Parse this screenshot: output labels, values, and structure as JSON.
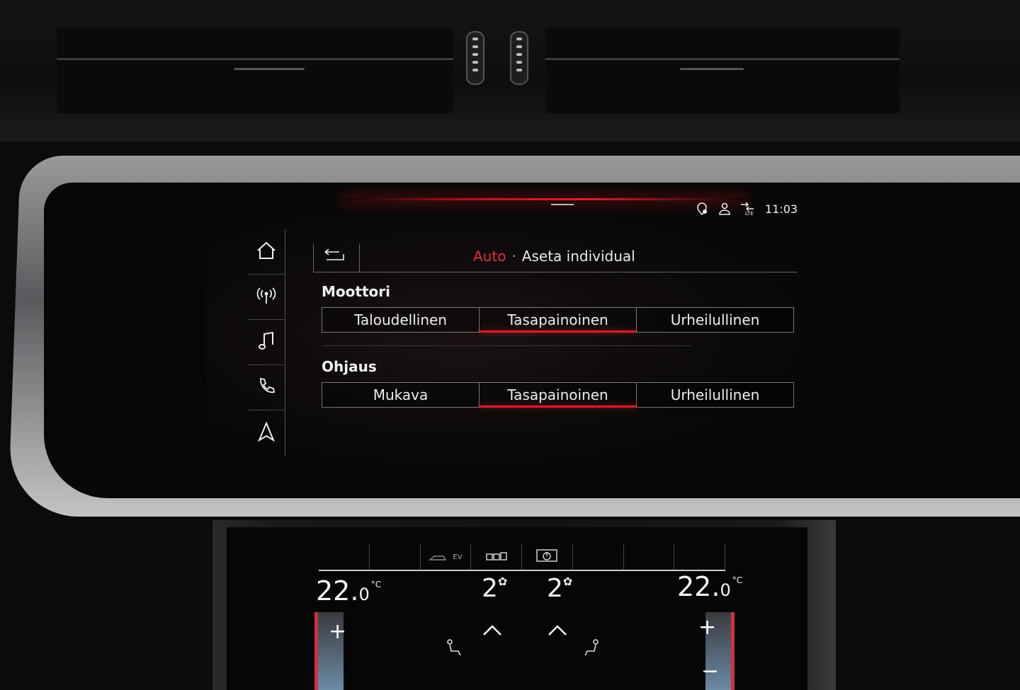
{
  "status_bar": {
    "time": "11:03",
    "icons": [
      "location-pin-icon",
      "user-profile-icon",
      "lte-signal-icon"
    ]
  },
  "sidebar": {
    "items": [
      {
        "id": "home",
        "icon": "home-icon"
      },
      {
        "id": "radio",
        "icon": "radio-antenna-icon"
      },
      {
        "id": "media",
        "icon": "music-note-icon"
      },
      {
        "id": "phone",
        "icon": "phone-icon"
      },
      {
        "id": "nav",
        "icon": "navigation-arrow-icon"
      }
    ]
  },
  "header": {
    "back_icon": "back-arrow-icon",
    "breadcrumb_parent": "Auto",
    "breadcrumb_separator": "·",
    "breadcrumb_current": "Aseta individual"
  },
  "sections": [
    {
      "title": "Moottori",
      "options": [
        "Taloudellinen",
        "Tasapainoinen",
        "Urheilullinen"
      ],
      "selected_index": 1
    },
    {
      "title": "Ohjaus",
      "options": [
        "Mukava",
        "Tasapainoinen",
        "Urheilullinen"
      ],
      "selected_index": 1
    }
  ],
  "colors": {
    "accent": "#d81e2a",
    "text": "#e9e9e9",
    "background": "#0a0808"
  },
  "climate": {
    "tabs": [
      "",
      "",
      "",
      "EV",
      "",
      "",
      "",
      ""
    ],
    "left_temp": "22",
    "left_temp_decimal": "0",
    "right_temp": "22",
    "right_temp_decimal": "0",
    "temp_unit": "°C",
    "left_fan": "2",
    "right_fan": "2",
    "plus": "+",
    "minus": "−"
  }
}
